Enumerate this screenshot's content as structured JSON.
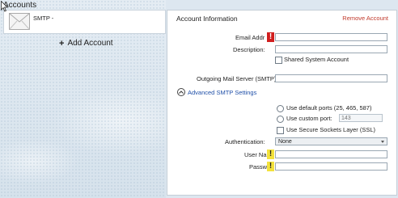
{
  "heading": "Accounts",
  "account": {
    "name": "SMTP -"
  },
  "add_account_label": "Add Account",
  "panel": {
    "title": "Account Information",
    "remove_label": "Remove Account",
    "email_label": "Email Addr",
    "email_value": "",
    "description_label": "Description:",
    "description_value": "",
    "shared_label": "Shared System Account",
    "shared_checked": false,
    "smtp_label": "Outgoing Mail Server (SMTP):",
    "smtp_value": "",
    "advanced_label": "Advanced SMTP Settings",
    "default_ports_label": "Use default ports (25, 465, 587)",
    "custom_port_label": "Use custom port:",
    "custom_port_placeholder": "143",
    "ssl_label": "Use Secure Sockets Layer (SSL)",
    "auth_label": "Authentication:",
    "auth_value": "None",
    "username_label": "User Na",
    "username_value": "",
    "password_label": "Passw",
    "password_value": ""
  },
  "warnings": {
    "email": "!",
    "username": "!",
    "password": "!"
  },
  "colors": {
    "remove": "#c0392b",
    "link": "#1f4fa8",
    "warn_red": "#d11e1e",
    "warn_yellow": "#f3e23c"
  }
}
